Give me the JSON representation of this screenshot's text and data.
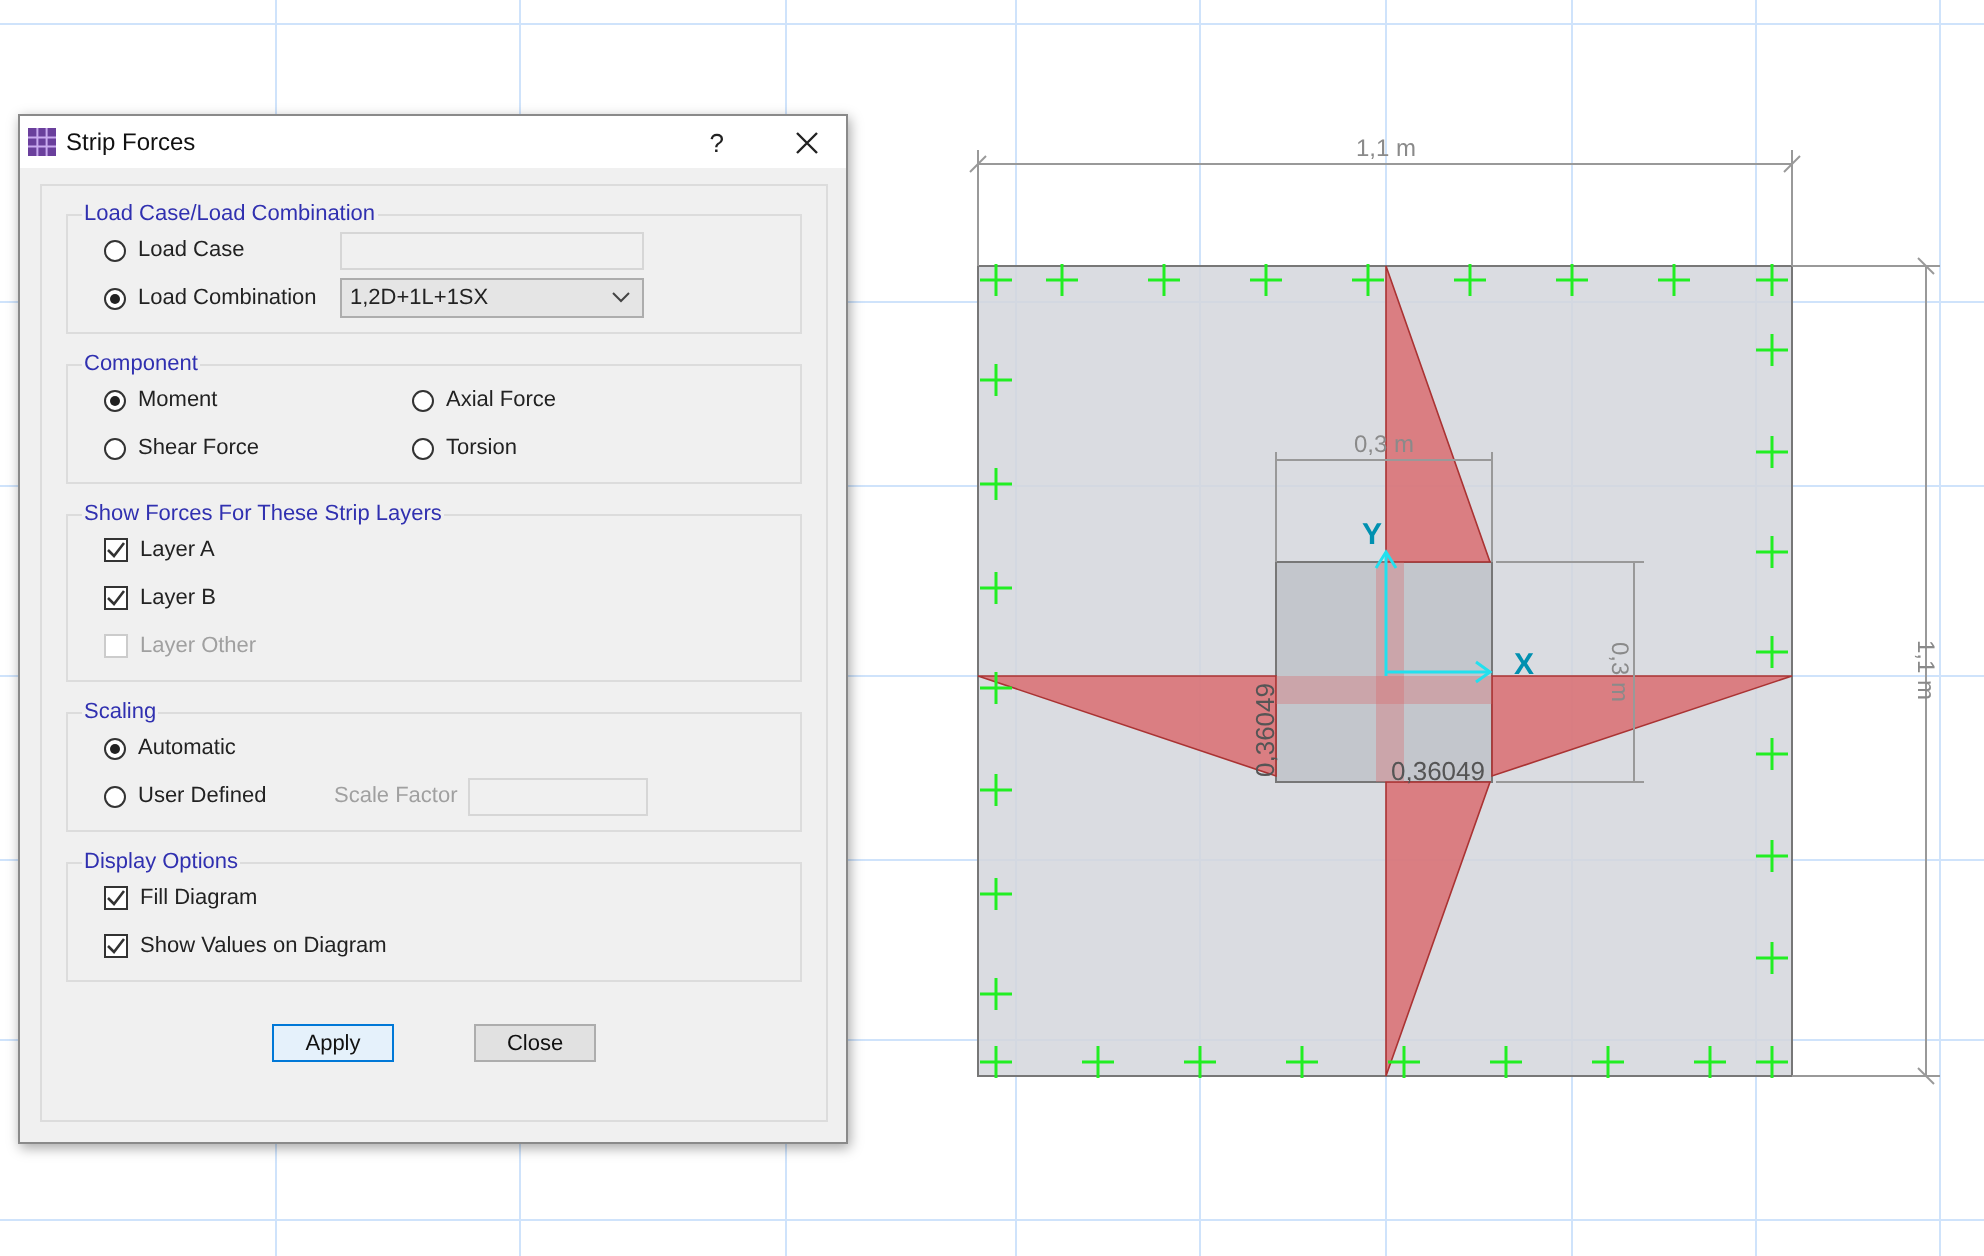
{
  "dialog": {
    "title": "Strip Forces",
    "help": "?",
    "load_group": {
      "title": "Load Case/Load Combination",
      "options": [
        {
          "label": "Load Case",
          "selected": false,
          "kind": "field"
        },
        {
          "label": "Load Combination",
          "selected": true,
          "kind": "combo",
          "value": "1,2D+1L+1SX"
        }
      ]
    },
    "component": {
      "title": "Component",
      "options": [
        {
          "label": "Moment",
          "selected": true
        },
        {
          "label": "Axial Force",
          "selected": false
        },
        {
          "label": "Shear Force",
          "selected": false
        },
        {
          "label": "Torsion",
          "selected": false
        }
      ]
    },
    "layers": {
      "title": "Show Forces For These Strip Layers",
      "items": [
        {
          "label": "Layer A",
          "checked": true,
          "disabled": false
        },
        {
          "label": "Layer B",
          "checked": true,
          "disabled": false
        },
        {
          "label": "Layer Other",
          "checked": false,
          "disabled": true
        }
      ]
    },
    "scaling": {
      "title": "Scaling",
      "options": [
        {
          "label": "Automatic",
          "selected": true
        },
        {
          "label": "User Defined",
          "selected": false
        }
      ],
      "scale_factor_label": "Scale Factor"
    },
    "display": {
      "title": "Display Options",
      "items": [
        {
          "label": "Fill Diagram",
          "checked": true
        },
        {
          "label": "Show Values on Diagram",
          "checked": true
        }
      ]
    },
    "buttons": [
      {
        "label": "Apply",
        "default": true
      },
      {
        "label": "Close",
        "default": false
      }
    ]
  },
  "drawing": {
    "slab_width": "1,1 m",
    "slab_height": "1,1 m",
    "column_width": "0,3 m",
    "column_height": "0,3 m",
    "values": [
      "0,36049",
      "0,36049"
    ],
    "x_axis": "X",
    "y_axis": "Y"
  }
}
